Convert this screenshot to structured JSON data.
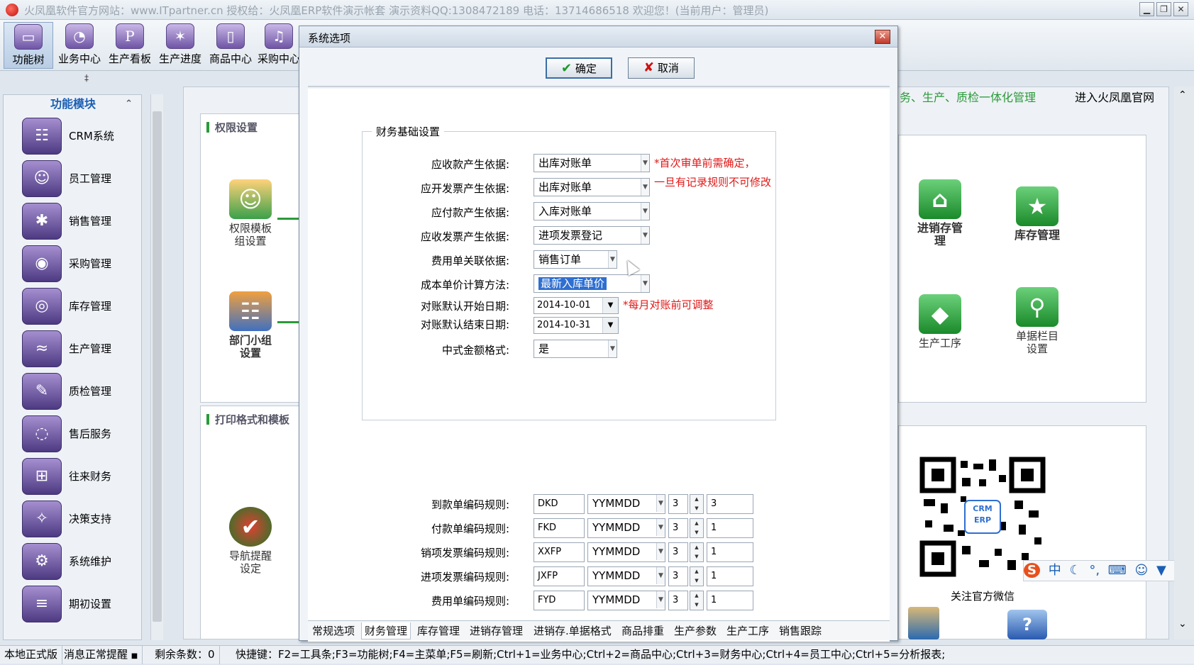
{
  "window": {
    "title": "火凤凰软件官方网站：www.ITpartner.cn  授权给：火凤凰ERP软件演示帐套  演示资料QQ:1308472189  电话：13714686518  欢迎您！(当前用户：管理员)"
  },
  "toolbar": {
    "items": [
      {
        "label": "功能树",
        "glyph": "▭"
      },
      {
        "label": "业务中心",
        "glyph": "◔"
      },
      {
        "label": "生产看板",
        "glyph": "P"
      },
      {
        "label": "生产进度",
        "glyph": "✶"
      },
      {
        "label": "商品中心",
        "glyph": "▯"
      },
      {
        "label": "采购中心",
        "glyph": "♫"
      }
    ],
    "collapse_glyph": "‡"
  },
  "left_panel": {
    "header": "功能模块",
    "modules": [
      {
        "label": "CRM系统",
        "glyph": "☷"
      },
      {
        "label": "员工管理",
        "glyph": "☺"
      },
      {
        "label": "销售管理",
        "glyph": "✱"
      },
      {
        "label": "采购管理",
        "glyph": "◉"
      },
      {
        "label": "库存管理",
        "glyph": "◎"
      },
      {
        "label": "生产管理",
        "glyph": "≈"
      },
      {
        "label": "质检管理",
        "glyph": "✎"
      },
      {
        "label": "售后服务",
        "glyph": "◌"
      },
      {
        "label": "往来财务",
        "glyph": "⊞"
      },
      {
        "label": "决策支持",
        "glyph": "✧"
      },
      {
        "label": "系统维护",
        "glyph": "⚙"
      },
      {
        "label": "期初设置",
        "glyph": "≡"
      }
    ]
  },
  "background": {
    "section_permission": "权限设置",
    "perm_template": "权限模板\n组设置",
    "dept_group": "部门小组\n设置",
    "section_print": "打印格式和模板",
    "nav_reminder": "导航提醒\n设定",
    "promo_green": "务、生产、质检一体化管理",
    "promo_link": "进入火凤凰官网",
    "inv_mgmt": "进销存管\n理",
    "stock_mgmt": "库存管理",
    "prod_process": "生产工序",
    "doc_columns": "单据栏目\n设置",
    "wechat_label": "关注官方微信",
    "qr_badge": "CRM\nERP"
  },
  "dialog": {
    "title": "系统选项",
    "ok_label": "确定",
    "cancel_label": "取消",
    "group_title": "财务基础设置",
    "fields": [
      {
        "label": "应收款产生依据:",
        "value": "出库对账单"
      },
      {
        "label": "应开发票产生依据:",
        "value": "出库对账单"
      },
      {
        "label": "应付款产生依据:",
        "value": "入库对账单"
      },
      {
        "label": "应收发票产生依据:",
        "value": "进项发票登记"
      },
      {
        "label": "费用单关联依据:",
        "value": "销售订单"
      },
      {
        "label": "成本单价计算方法:",
        "value": "最新入库单价"
      }
    ],
    "start_date_label": "对账默认开始日期:",
    "start_date": "2014-10-01",
    "end_date_label": "对账默认结束日期:",
    "end_date": "2014-10-31",
    "cn_money_label": "中式金额格式:",
    "cn_money_value": "是",
    "note1": "*首次审单前需确定，",
    "note2": "一旦有记录规则不可修改",
    "note3": "*每月对账前可调整",
    "code_rules": [
      {
        "label": "到款单编码规则:",
        "prefix": "DKD",
        "format": "YYMMDD",
        "digits": "3",
        "start": "3"
      },
      {
        "label": "付款单编码规则:",
        "prefix": "FKD",
        "format": "YYMMDD",
        "digits": "3",
        "start": "1"
      },
      {
        "label": "销项发票编码规则:",
        "prefix": "XXFP",
        "format": "YYMMDD",
        "digits": "3",
        "start": "1"
      },
      {
        "label": "进项发票编码规则:",
        "prefix": "JXFP",
        "format": "YYMMDD",
        "digits": "3",
        "start": "1"
      },
      {
        "label": "费用单编码规则:",
        "prefix": "FYD",
        "format": "YYMMDD",
        "digits": "3",
        "start": "1"
      }
    ],
    "tabs": [
      "常规选项",
      "财务管理",
      "库存管理",
      "进销存管理",
      "进销存.单据格式",
      "商品排重",
      "生产参数",
      "生产工序",
      "销售跟踪"
    ],
    "active_tab": "财务管理"
  },
  "statusbar": {
    "mode": "本地正式版",
    "msg": "消息正常提醒",
    "remaining": "剩余条数：0",
    "shortcuts": "快捷键：F2=工具条;F3=功能树;F4=主菜单;F5=刷新;Ctrl+1=业务中心;Ctrl+2=商品中心;Ctrl+3=财务中心;Ctrl+4=员工中心;Ctrl+5=分析报表;"
  },
  "ime": {
    "label": "中"
  },
  "colors": {
    "accent": "#1a5fb4",
    "note_red": "#e01818",
    "green": "#2a9a3a",
    "selection": "#2f6fd1"
  }
}
